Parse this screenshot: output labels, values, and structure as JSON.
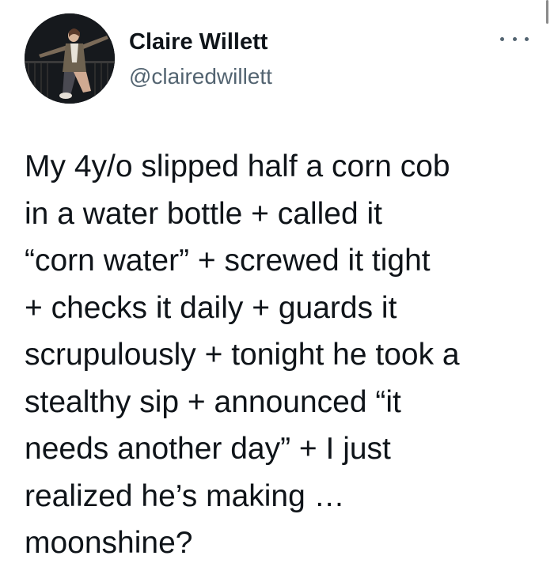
{
  "author": {
    "display_name": "Claire Willett",
    "handle": "@clairedwillett",
    "avatar_icon": "profile-photo"
  },
  "menu": {
    "icon": "more-horizontal-icon"
  },
  "tweet": {
    "lines": [
      "My 4y/o slipped half a corn cob",
      "in a water bottle + called it",
      "“corn water” + screwed it tight",
      "+ checks it daily + guards it",
      "scrupulously + tonight he took a",
      "stealthy sip + announced “it",
      "needs another day” + I just",
      "realized he’s making …",
      "moonshine?"
    ]
  },
  "colors": {
    "text": "#0f1419",
    "secondary": "#536471",
    "background": "#ffffff"
  }
}
